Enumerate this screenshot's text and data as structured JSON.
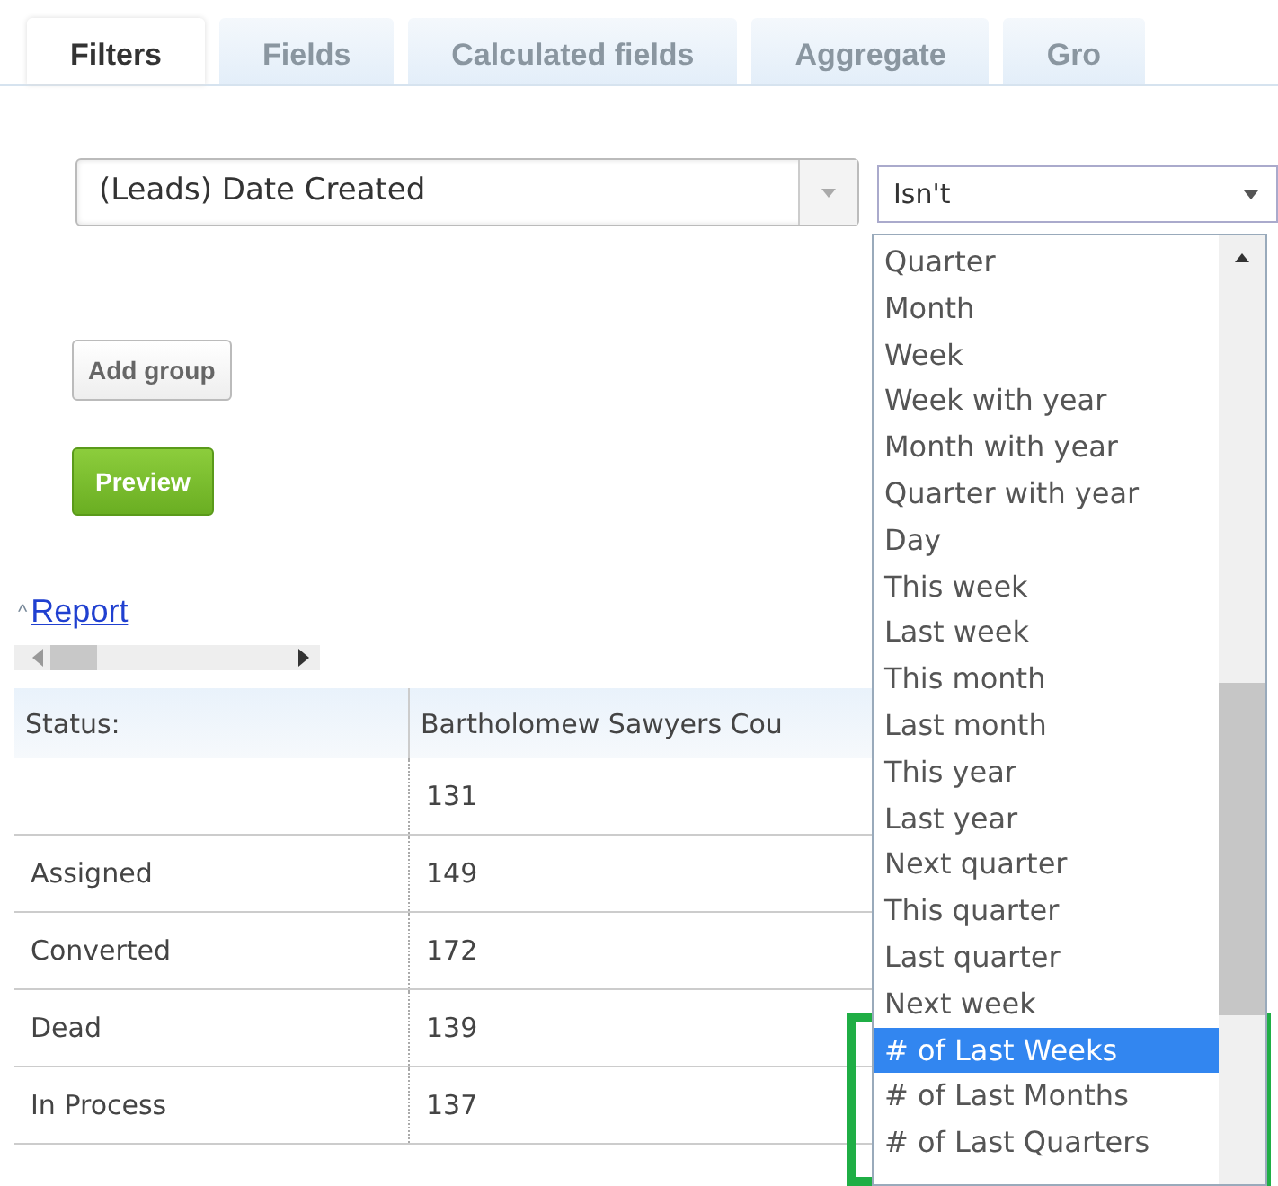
{
  "tabs": [
    {
      "label": "Filters",
      "selected": true
    },
    {
      "label": "Fields",
      "selected": false
    },
    {
      "label": "Calculated fields",
      "selected": false
    },
    {
      "label": "Aggregate",
      "selected": false
    },
    {
      "label": "Gro",
      "selected": false
    }
  ],
  "filter": {
    "field": "(Leads) Date Created",
    "operator": "Isn't"
  },
  "operator_options": [
    {
      "label": "Quarter",
      "selected": false
    },
    {
      "label": "Month",
      "selected": false
    },
    {
      "label": "Week",
      "selected": false
    },
    {
      "label": "Week with year",
      "selected": false
    },
    {
      "label": "Month with year",
      "selected": false
    },
    {
      "label": "Quarter with year",
      "selected": false
    },
    {
      "label": "Day",
      "selected": false
    },
    {
      "label": "This week",
      "selected": false
    },
    {
      "label": "Last week",
      "selected": false
    },
    {
      "label": "This month",
      "selected": false
    },
    {
      "label": "Last month",
      "selected": false
    },
    {
      "label": "This year",
      "selected": false
    },
    {
      "label": "Last year",
      "selected": false
    },
    {
      "label": "Next quarter",
      "selected": false
    },
    {
      "label": "This quarter",
      "selected": false
    },
    {
      "label": "Last quarter",
      "selected": false
    },
    {
      "label": "Next week",
      "selected": false
    },
    {
      "label": "# of Last Weeks",
      "selected": true
    },
    {
      "label": "# of Last Months",
      "selected": false
    },
    {
      "label": "# of Last Quarters",
      "selected": false
    }
  ],
  "buttons": {
    "add_group": "Add group",
    "preview": "Preview"
  },
  "report": {
    "toggle": "^",
    "title": "Report"
  },
  "table": {
    "columns": [
      "Status:",
      "Bartholomew Sawyers Cou"
    ],
    "rows": [
      [
        "",
        "131"
      ],
      [
        "Assigned",
        "149"
      ],
      [
        "Converted",
        "172"
      ],
      [
        "Dead",
        "139"
      ],
      [
        "In Process",
        "137"
      ]
    ]
  }
}
